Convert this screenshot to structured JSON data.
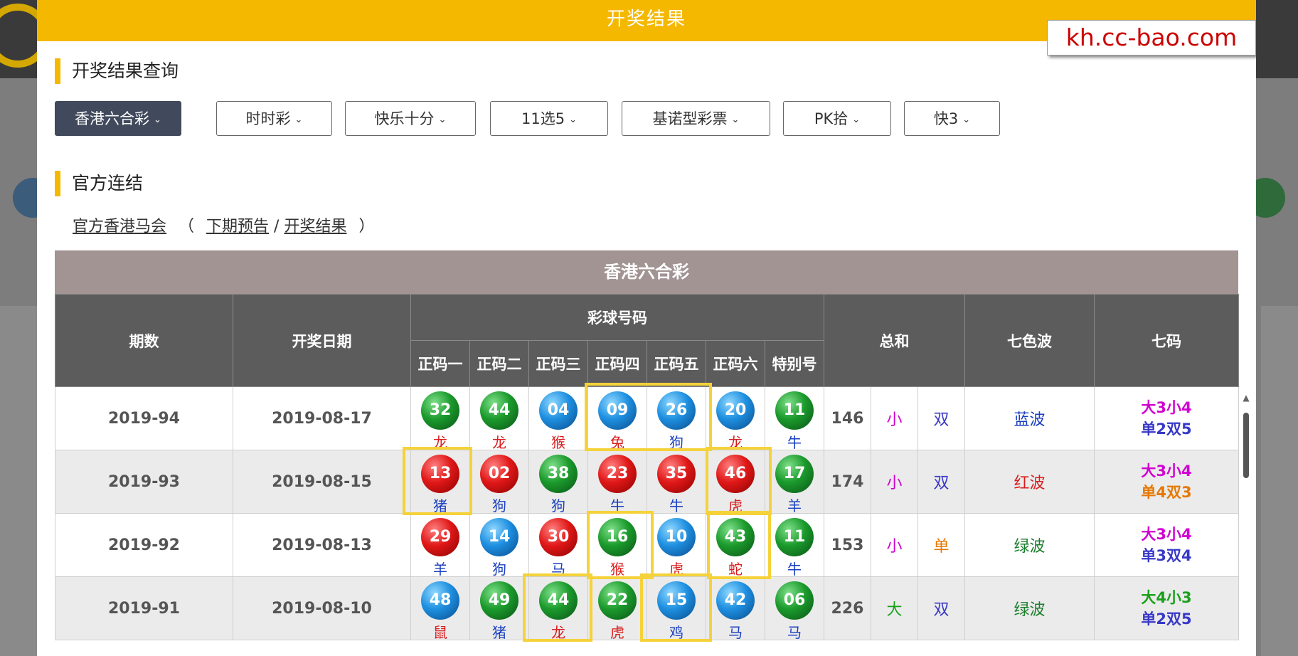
{
  "modal": {
    "title": "开奖结果",
    "watermark": "kh.cc-bao.com"
  },
  "sections": {
    "query_title": "开奖结果查询",
    "official_title": "官方连结"
  },
  "categories": [
    {
      "label": "香港六合彩",
      "active": true
    },
    {
      "label": "时时彩",
      "active": false
    },
    {
      "label": "快乐十分",
      "active": false
    },
    {
      "label": "11选5",
      "active": false
    },
    {
      "label": "基诺型彩票",
      "active": false
    },
    {
      "label": "PK拾",
      "active": false
    },
    {
      "label": "快3",
      "active": false
    }
  ],
  "links": {
    "official": "官方香港马会",
    "open_paren": "（",
    "next_preview": "下期预告",
    "separator": "/",
    "results": "开奖结果",
    "close_paren": "）"
  },
  "table": {
    "title": "香港六合彩",
    "headers": {
      "period": "期数",
      "date": "开奖日期",
      "balls": "彩球号码",
      "sub": [
        "正码一",
        "正码二",
        "正码三",
        "正码四",
        "正码五",
        "正码六",
        "特别号"
      ],
      "sum": "总和",
      "wave": "七色波",
      "qima": "七码"
    },
    "rows": [
      {
        "period": "2019-94",
        "date": "2019-08-17",
        "balls": [
          {
            "n": "32",
            "c": "green",
            "z": "龙",
            "zc": "red"
          },
          {
            "n": "44",
            "c": "green",
            "z": "龙",
            "zc": "red"
          },
          {
            "n": "04",
            "c": "blue",
            "z": "猴",
            "zc": "red"
          },
          {
            "n": "09",
            "c": "blue",
            "z": "兔",
            "zc": "red"
          },
          {
            "n": "26",
            "c": "blue",
            "z": "狗",
            "zc": "blue"
          },
          {
            "n": "20",
            "c": "blue",
            "z": "龙",
            "zc": "red"
          },
          {
            "n": "11",
            "c": "green",
            "z": "牛",
            "zc": "blue"
          }
        ],
        "sum": "146",
        "size": "小",
        "size_class": "small",
        "oe": "双",
        "oe_class": "even",
        "wave": "蓝波",
        "wave_class": "blue",
        "qm1": "大3小4",
        "qm1_class": "small",
        "qm2": "单2双5",
        "qm2_class": "even"
      },
      {
        "period": "2019-93",
        "date": "2019-08-15",
        "balls": [
          {
            "n": "13",
            "c": "red",
            "z": "猪",
            "zc": "blue"
          },
          {
            "n": "02",
            "c": "red",
            "z": "狗",
            "zc": "blue"
          },
          {
            "n": "38",
            "c": "green",
            "z": "狗",
            "zc": "blue"
          },
          {
            "n": "23",
            "c": "red",
            "z": "牛",
            "zc": "blue"
          },
          {
            "n": "35",
            "c": "red",
            "z": "牛",
            "zc": "blue"
          },
          {
            "n": "46",
            "c": "red",
            "z": "虎",
            "zc": "red"
          },
          {
            "n": "17",
            "c": "green",
            "z": "羊",
            "zc": "blue"
          }
        ],
        "sum": "174",
        "size": "小",
        "size_class": "small",
        "oe": "双",
        "oe_class": "even",
        "wave": "红波",
        "wave_class": "red",
        "qm1": "大3小4",
        "qm1_class": "small",
        "qm2": "单4双3",
        "qm2_class": "odd"
      },
      {
        "period": "2019-92",
        "date": "2019-08-13",
        "balls": [
          {
            "n": "29",
            "c": "red",
            "z": "羊",
            "zc": "blue"
          },
          {
            "n": "14",
            "c": "blue",
            "z": "狗",
            "zc": "blue"
          },
          {
            "n": "30",
            "c": "red",
            "z": "马",
            "zc": "blue"
          },
          {
            "n": "16",
            "c": "green",
            "z": "猴",
            "zc": "red"
          },
          {
            "n": "10",
            "c": "blue",
            "z": "虎",
            "zc": "red"
          },
          {
            "n": "43",
            "c": "green",
            "z": "蛇",
            "zc": "red"
          },
          {
            "n": "11",
            "c": "green",
            "z": "牛",
            "zc": "blue"
          }
        ],
        "sum": "153",
        "size": "小",
        "size_class": "small",
        "oe": "单",
        "oe_class": "odd",
        "wave": "绿波",
        "wave_class": "green",
        "qm1": "大3小4",
        "qm1_class": "small",
        "qm2": "单3双4",
        "qm2_class": "even"
      },
      {
        "period": "2019-91",
        "date": "2019-08-10",
        "balls": [
          {
            "n": "48",
            "c": "blue",
            "z": "鼠",
            "zc": "red"
          },
          {
            "n": "49",
            "c": "green",
            "z": "猪",
            "zc": "blue"
          },
          {
            "n": "44",
            "c": "green",
            "z": "龙",
            "zc": "red"
          },
          {
            "n": "22",
            "c": "green",
            "z": "虎",
            "zc": "red"
          },
          {
            "n": "15",
            "c": "blue",
            "z": "鸡",
            "zc": "blue"
          },
          {
            "n": "42",
            "c": "blue",
            "z": "马",
            "zc": "blue"
          },
          {
            "n": "06",
            "c": "green",
            "z": "马",
            "zc": "blue"
          }
        ],
        "sum": "226",
        "size": "大",
        "size_class": "big",
        "oe": "双",
        "oe_class": "even",
        "wave": "绿波",
        "wave_class": "green",
        "qm1": "大4小3",
        "qm1_class": "big",
        "qm2": "单2双5",
        "qm2_class": "even"
      }
    ]
  },
  "colors": {
    "header_yellow": "#f5b800",
    "active_btn": "#404a5c",
    "highlight_yellow": "#f5d23a",
    "ball_red": "#e01818",
    "ball_blue": "#1e8fe0",
    "ball_green": "#1b9a2c"
  },
  "icons": {
    "dropdown": "chevron-down-icon",
    "scroll_up": "scroll-up-arrow-icon"
  }
}
